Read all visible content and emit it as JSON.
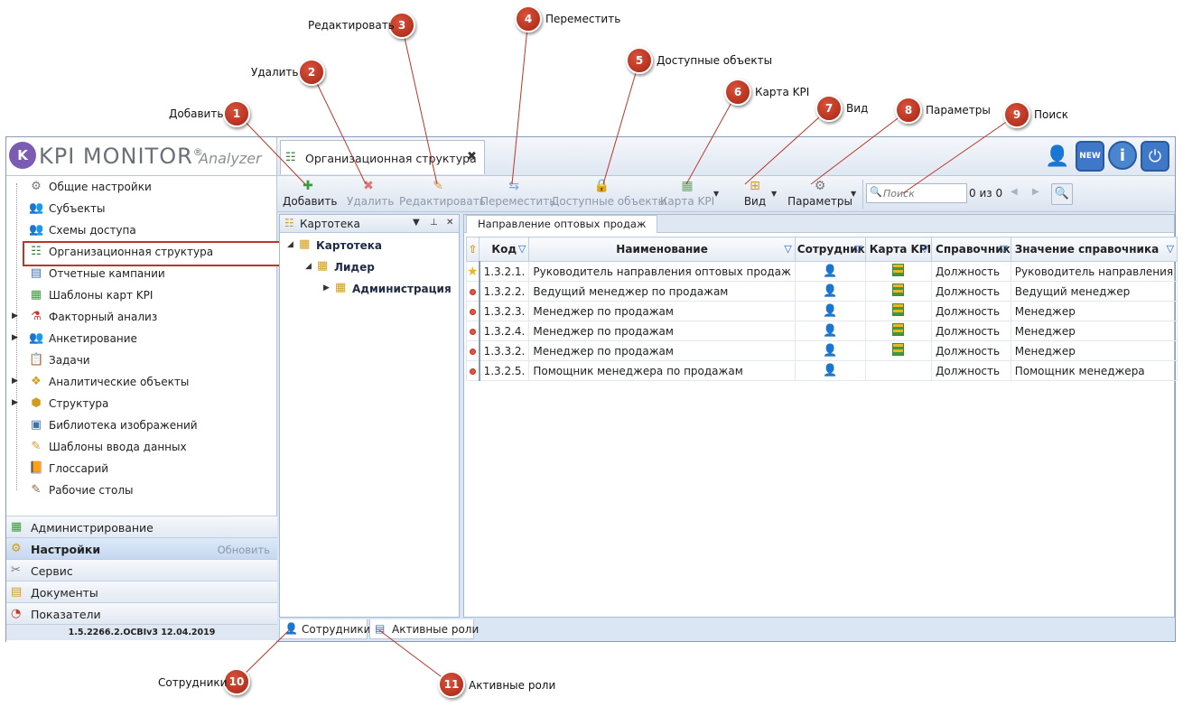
{
  "callouts": [
    {
      "num": "1",
      "label": "Добавить"
    },
    {
      "num": "2",
      "label": "Удалить"
    },
    {
      "num": "3",
      "label": "Редактировать"
    },
    {
      "num": "4",
      "label": "Переместить"
    },
    {
      "num": "5",
      "label": "Доступные объекты"
    },
    {
      "num": "6",
      "label": "Карта KPI"
    },
    {
      "num": "7",
      "label": "Вид"
    },
    {
      "num": "8",
      "label": "Параметры"
    },
    {
      "num": "9",
      "label": "Поиск"
    },
    {
      "num": "10",
      "label": "Сотрудники"
    },
    {
      "num": "11",
      "label": "Активные роли"
    }
  ],
  "app": {
    "logo_mark": "K",
    "logo_name": "KPI MONITOR",
    "logo_reg": "®",
    "logo_sub": "Analyzer",
    "doc_tab": "Организационная структура",
    "new_badge": "NEW"
  },
  "sidebar": {
    "items": [
      {
        "label": "Общие настройки",
        "icon": "gear-icon"
      },
      {
        "label": "Субъекты",
        "icon": "users-icon"
      },
      {
        "label": "Схемы доступа",
        "icon": "access-icon"
      },
      {
        "label": "Организационная структура",
        "icon": "org-icon"
      },
      {
        "label": "Отчетные кампании",
        "icon": "report-icon"
      },
      {
        "label": "Шаблоны карт KPI",
        "icon": "kpi-template-icon"
      },
      {
        "label": "Факторный анализ",
        "icon": "beta-icon"
      },
      {
        "label": "Анкетирование",
        "icon": "survey-icon"
      },
      {
        "label": "Задачи",
        "icon": "tasks-icon"
      },
      {
        "label": "Аналитические объекты",
        "icon": "analytics-icon"
      },
      {
        "label": "Структура",
        "icon": "structure-icon"
      },
      {
        "label": "Библиотека изображений",
        "icon": "images-icon"
      },
      {
        "label": "Шаблоны ввода данных",
        "icon": "input-template-icon"
      },
      {
        "label": "Глоссарий",
        "icon": "glossary-icon"
      },
      {
        "label": "Рабочие столы",
        "icon": "desktop-icon"
      }
    ],
    "sections": [
      {
        "label": "Администрирование"
      },
      {
        "label": "Настройки",
        "extra": "Обновить"
      },
      {
        "label": "Сервис"
      },
      {
        "label": "Документы"
      },
      {
        "label": "Показатели"
      }
    ],
    "version": "1.5.2266.2.OCBIv3  12.04.2019"
  },
  "toolbar": {
    "add": "Добавить",
    "delete": "Удалить",
    "edit": "Редактировать",
    "move": "Переместить",
    "available": "Доступные объекты",
    "kpi_map": "Карта KPI",
    "view": "Вид",
    "params": "Параметры",
    "search_placeholder": "Поиск",
    "count": "0 из 0"
  },
  "catalog": {
    "title": "Картотека",
    "nodes": [
      {
        "label": "Картотека"
      },
      {
        "label": "Лидер"
      },
      {
        "label": "Администрация"
      }
    ]
  },
  "grid": {
    "tab": "Направление оптовых продаж",
    "columns": [
      "Код",
      "Наименование",
      "Сотрудник",
      "Карта KPI",
      "Справочник",
      "Значение справочника"
    ],
    "rows": [
      {
        "code": "1.3.2.1.",
        "name": "Руководитель направления оптовых продаж",
        "ref": "Должность",
        "value": "Руководитель направления",
        "marker": "star",
        "kpi": true
      },
      {
        "code": "1.3.2.2.",
        "name": "Ведущий менеджер по продажам",
        "ref": "Должность",
        "value": "Ведущий менеджер",
        "marker": "dot",
        "kpi": true
      },
      {
        "code": "1.3.2.3.",
        "name": "Менеджер по продажам",
        "ref": "Должность",
        "value": "Менеджер",
        "marker": "dot",
        "kpi": true
      },
      {
        "code": "1.3.2.4.",
        "name": "Менеджер по продажам",
        "ref": "Должность",
        "value": "Менеджер",
        "marker": "dot",
        "kpi": true
      },
      {
        "code": "1.3.3.2.",
        "name": "Менеджер по продажам",
        "ref": "Должность",
        "value": "Менеджер",
        "marker": "dot",
        "kpi": true
      },
      {
        "code": "1.3.2.5.",
        "name": "Помощник менеджера по продажам",
        "ref": "Должность",
        "value": "Помощник менеджера",
        "marker": "dot",
        "kpi": false
      }
    ]
  },
  "bottom_tabs": {
    "employees": "Сотрудники",
    "roles": "Активные роли"
  },
  "colors": {
    "callout": "#b5321f",
    "selection_outline": "#b7372a",
    "filter_icon": "#1f63c6"
  }
}
